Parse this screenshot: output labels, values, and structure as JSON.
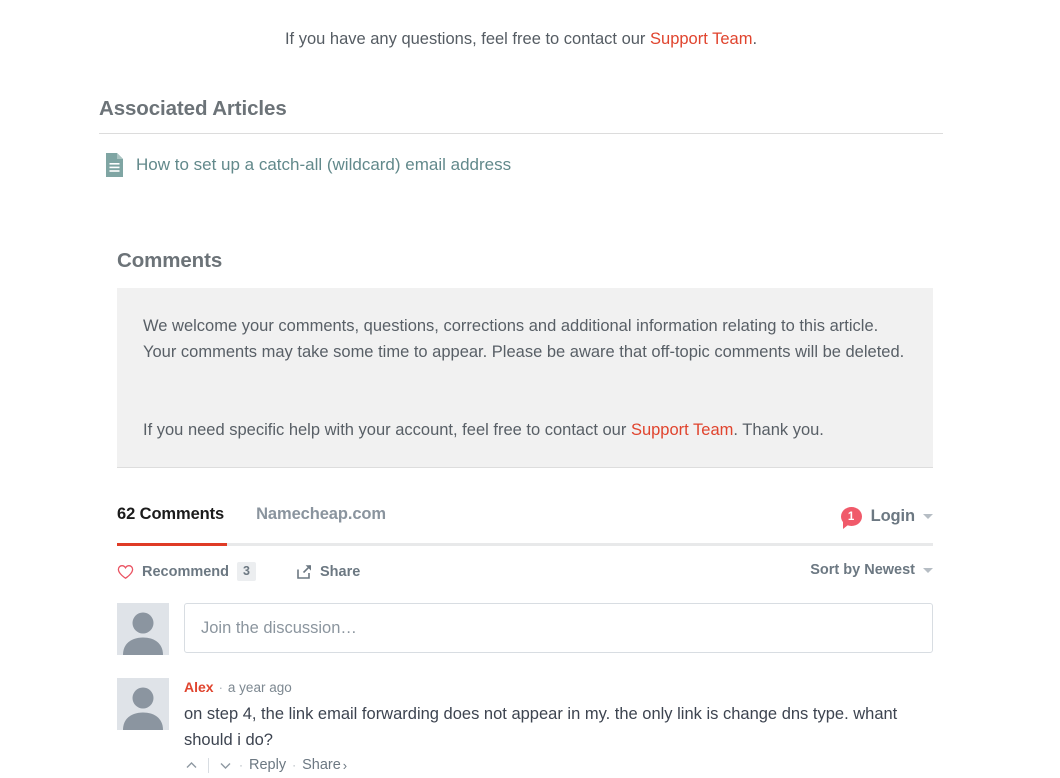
{
  "contact": {
    "text_before": "If you have any questions, feel free to contact our ",
    "link": "Support Team",
    "text_after": "."
  },
  "associated_articles": {
    "heading": "Associated Articles",
    "items": [
      {
        "icon": "document-icon",
        "title": "How to set up a catch-all (wildcard) email address"
      }
    ]
  },
  "comments_section": {
    "heading": "Comments",
    "notice": {
      "paragraph1": "We welcome your comments, questions, corrections and additional information relating to this article. Your comments may take some time to appear. Please be aware that off-topic comments will be deleted.",
      "paragraph2_before": "If you need specific help with your account, feel free to contact our ",
      "paragraph2_link": "Support Team",
      "paragraph2_after": ". Thank you."
    }
  },
  "disqus": {
    "tabs": {
      "active_label": "62 Comments",
      "site_label": "Namecheap.com"
    },
    "login": {
      "badge_count": "1",
      "label": "Login"
    },
    "recommend": {
      "label": "Recommend",
      "count": "3"
    },
    "share": {
      "label": "Share"
    },
    "sort": {
      "label": "Sort by Newest"
    },
    "compose": {
      "placeholder": "Join the discussion…"
    },
    "comments": [
      {
        "author": "Alex",
        "separator": "·",
        "time": "a year ago",
        "text": "on step 4, the link email forwarding does not appear in my. the only link is change dns type. whant should i do?",
        "reply_label": "Reply",
        "share_label": "Share",
        "share_chevron": "›"
      }
    ]
  },
  "colors": {
    "link_red": "#e0442e",
    "accent_red": "#df3b26",
    "heading_gray": "#6c7378",
    "article_link_teal": "#62898b",
    "notice_bg": "#f1f1f1",
    "badge_pink": "#f05a6a"
  }
}
